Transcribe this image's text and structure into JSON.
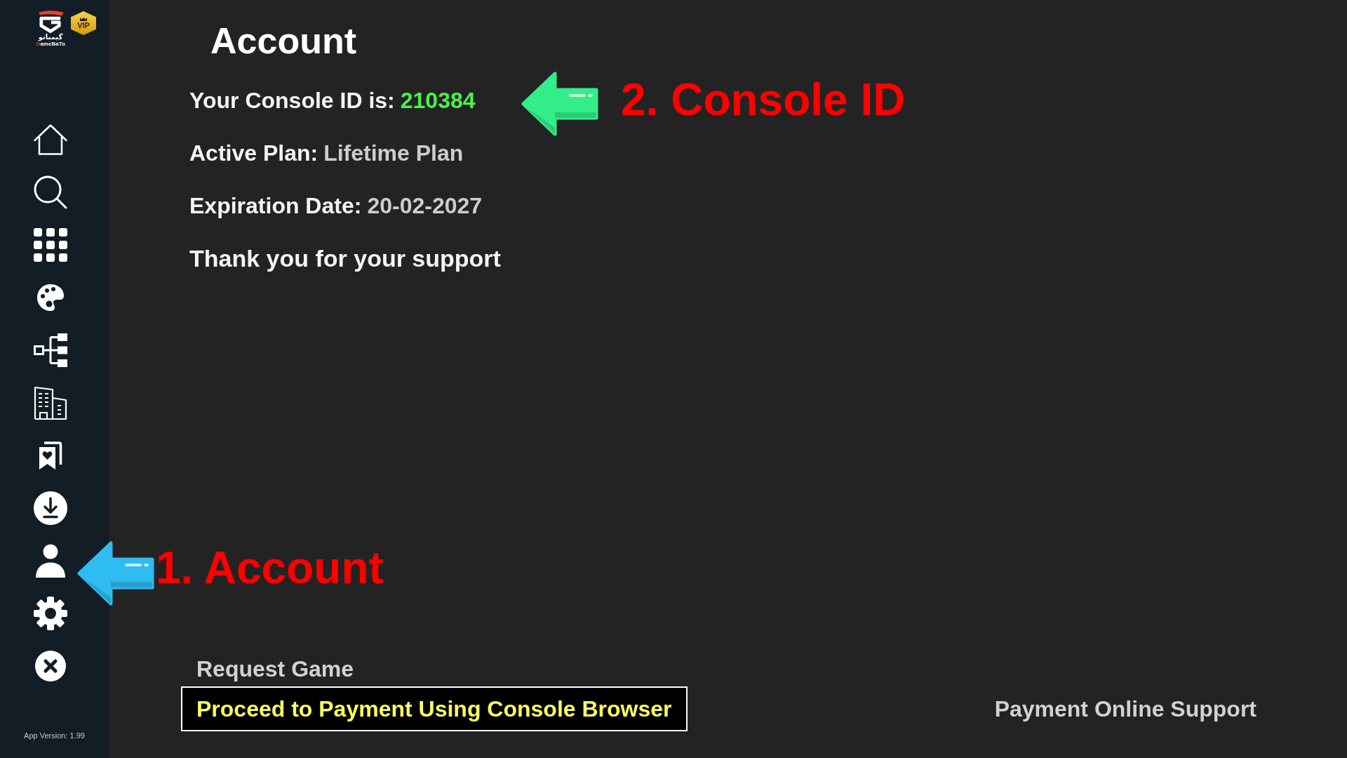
{
  "sidebar": {
    "logo": {
      "wordmark_fa": "گیمباتو",
      "wordmark": "GameBaTo",
      "badge": "VIP"
    },
    "app_version": "App Version: 1.99"
  },
  "account": {
    "title": "Account",
    "console_id": {
      "label": "Your Console ID is:",
      "value": "210384"
    },
    "active_plan": {
      "label": "Active Plan:",
      "value": "Lifetime Plan"
    },
    "expiration_date": {
      "label": "Expiration Date:",
      "value": "20-02-2027"
    },
    "message": "Thank you for your support"
  },
  "actions": {
    "request_game": {
      "label": "Request Game",
      "selected": false
    },
    "payment_options": [
      {
        "label": "Proceed to Payment Using Console Browser",
        "selected": true
      },
      {
        "label": "Payment Online Support",
        "selected": false
      }
    ]
  },
  "annotations": [
    {
      "label": "1. Account",
      "color": "#2fbcf0"
    },
    {
      "label": "2. Console ID",
      "color": "#33ee88"
    }
  ]
}
